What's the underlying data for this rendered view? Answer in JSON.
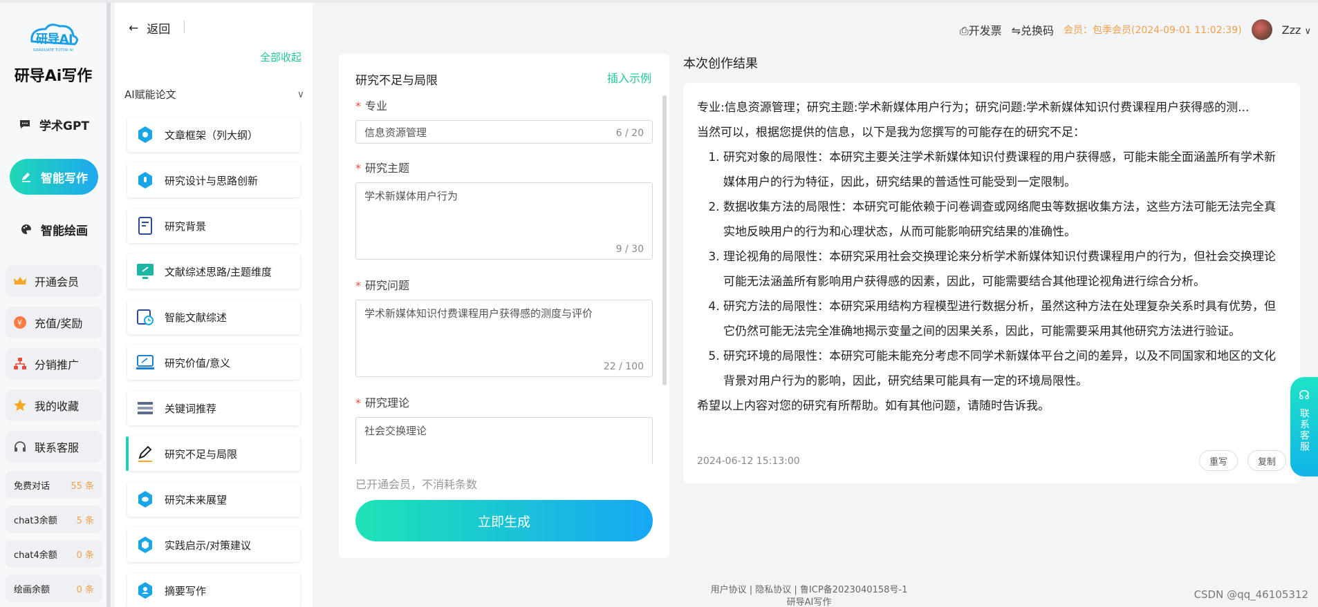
{
  "brand": {
    "logo_text": "研导AI",
    "logo_sub": "GRADUATE TUTOR AI",
    "name": "研导Ai写作"
  },
  "nav": [
    {
      "label": "学术GPT",
      "icon": "chat-icon",
      "active": false
    },
    {
      "label": "智能写作",
      "icon": "pen-icon",
      "active": true
    },
    {
      "label": "智能绘画",
      "icon": "palette-icon",
      "active": false
    }
  ],
  "utilities": [
    {
      "label": "开通会员",
      "icon": "crown-icon"
    },
    {
      "label": "充值/奖励",
      "icon": "coin-icon"
    },
    {
      "label": "分销推广",
      "icon": "org-icon"
    },
    {
      "label": "我的收藏",
      "icon": "star-icon"
    },
    {
      "label": "联系客服",
      "icon": "headset-icon"
    }
  ],
  "quotas": [
    {
      "label": "免费对话",
      "count": "55 条"
    },
    {
      "label": "chat3余额",
      "count": "5 条"
    },
    {
      "label": "chat4余额",
      "count": "0 条"
    },
    {
      "label": "绘画余额",
      "count": "0 条"
    }
  ],
  "sidebar": {
    "back_label": "返回",
    "collapse_all": "全部收起",
    "section": "AI赋能论文",
    "items": [
      {
        "label": "文章框架（列大纲）",
        "icon": "framework-icon"
      },
      {
        "label": "研究设计与思路创新",
        "icon": "lightbulb-icon"
      },
      {
        "label": "研究背景",
        "icon": "document-icon"
      },
      {
        "label": "文献综述思路/主题维度",
        "icon": "monitor-icon"
      },
      {
        "label": "智能文献综述",
        "icon": "calendar-clock-icon"
      },
      {
        "label": "研究价值/意义",
        "icon": "laptop-icon"
      },
      {
        "label": "关键词推荐",
        "icon": "list-icon"
      },
      {
        "label": "研究不足与局限",
        "icon": "pencil-icon"
      },
      {
        "label": "研究未来展望",
        "icon": "chat-bubble-icon"
      },
      {
        "label": "实践启示/对策建议",
        "icon": "hexagon-icon"
      },
      {
        "label": "摘要写作",
        "icon": "user-circle-icon"
      }
    ]
  },
  "form": {
    "title": "研究不足与局限",
    "insert_example": "插入示例",
    "fields": {
      "major": {
        "label": "专业",
        "value": "信息资源管理",
        "count": "6 / 20"
      },
      "topic": {
        "label": "研究主题",
        "value": "学术新媒体用户行为",
        "count": "9 / 30"
      },
      "question": {
        "label": "研究问题",
        "value": "学术新媒体知识付费课程用户获得感的测度与评价",
        "count": "22 / 100"
      },
      "theory": {
        "label": "研究理论",
        "value": "社会交换理论"
      }
    },
    "member_note": "已开通会员，不消耗条数",
    "generate_button": "立即生成"
  },
  "header": {
    "invoice": "开发票",
    "redeem": "兑换码",
    "membership": "会员：包季会员(2024-09-01 11:02:39)",
    "username": "Zzz"
  },
  "result": {
    "title": "本次创作结果",
    "query": "专业:信息资源管理；研究主题:学术新媒体用户行为；研究问题:学术新媒体知识付费课程用户获得感的测...",
    "intro": "当然可以，根据您提供的信息，以下是我为您撰写的可能存在的研究不足：",
    "points": [
      "研究对象的局限性：本研究主要关注学术新媒体知识付费课程的用户获得感，可能未能全面涵盖所有学术新媒体用户的行为特征，因此，研究结果的普适性可能受到一定限制。",
      "数据收集方法的局限性：本研究可能依赖于问卷调查或网络爬虫等数据收集方法，这些方法可能无法完全真实地反映用户的行为和心理状态，从而可能影响研究结果的准确性。",
      "理论视角的局限性：本研究采用社会交换理论来分析学术新媒体知识付费课程用户的行为，但社会交换理论可能无法涵盖所有影响用户获得感的因素，因此，可能需要结合其他理论视角进行综合分析。",
      "研究方法的局限性：本研究采用结构方程模型进行数据分析，虽然这种方法在处理复杂关系时具有优势，但它仍然可能无法完全准确地揭示变量之间的因果关系，因此，可能需要采用其他研究方法进行验证。",
      "研究环境的局限性：本研究可能未能充分考虑不同学术新媒体平台之间的差异，以及不同国家和地区的文化背景对用户行为的影响，因此，研究结果可能具有一定的环境局限性。"
    ],
    "closing": "希望以上内容对您的研究有所帮助。如有其他问题，请随时告诉我。",
    "timestamp": "2024-06-12 15:13:00",
    "rewrite": "重写",
    "copy": "复制"
  },
  "float_service": "联系客服",
  "footer": {
    "links": "用户协议 | 隐私协议 | 鲁ICP备2023040158号-1",
    "name": "研导AI写作"
  },
  "watermark": "CSDN @qq_46105312",
  "colors": {
    "accent": "#20c997",
    "gradient_start": "#1ee3b6",
    "gradient_end": "#17a7f4",
    "vip": "#f0a04a"
  }
}
